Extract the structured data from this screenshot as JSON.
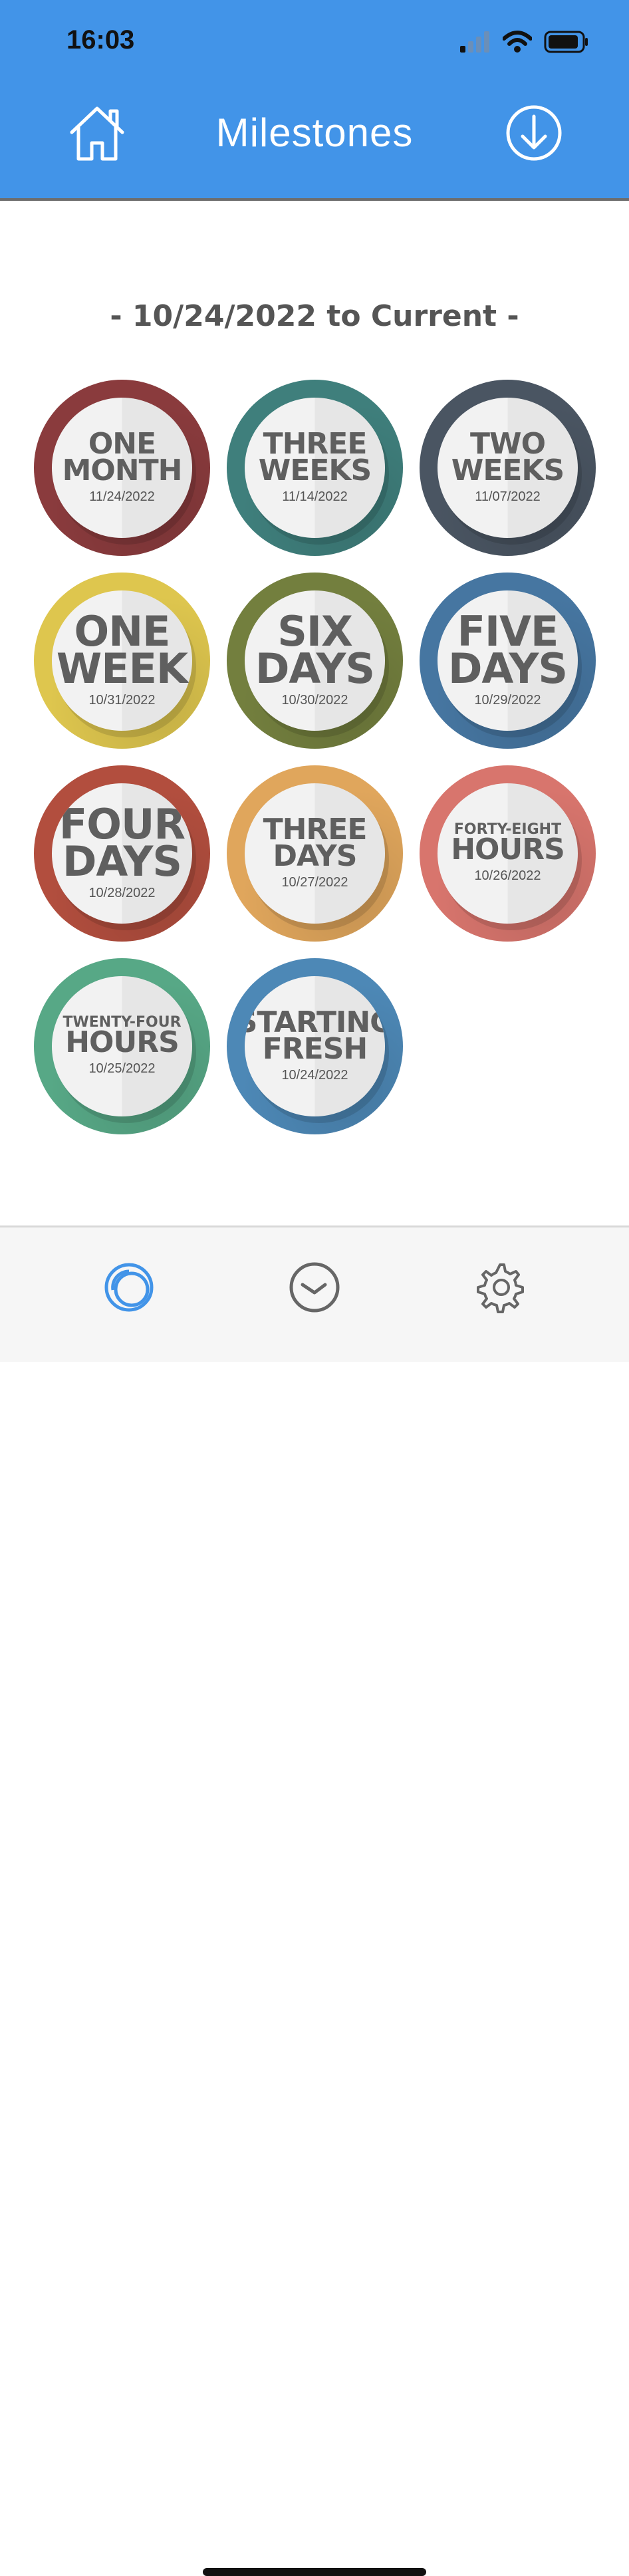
{
  "status_bar": {
    "time": "16:03"
  },
  "header": {
    "title": "Milestones",
    "left_icon": "home-icon",
    "right_icon": "download-circle-icon",
    "color": "#4294E8"
  },
  "date_range": "- 10/24/2022 to Current -",
  "milestones": [
    {
      "line1": "ONE",
      "line2": "MONTH",
      "date": "11/24/2022",
      "color": "#8A3B3D"
    },
    {
      "line1": "THREE",
      "line2": "WEEKS",
      "date": "11/14/2022",
      "color": "#3F7F7C"
    },
    {
      "line1": "TWO",
      "line2": "WEEKS",
      "date": "11/07/2022",
      "color": "#4A5562"
    },
    {
      "line1": "ONE",
      "line2": "WEEK",
      "date": "10/31/2022",
      "color": "#DEC64E"
    },
    {
      "line1": "SIX",
      "line2": "DAYS",
      "date": "10/30/2022",
      "color": "#737F3E"
    },
    {
      "line1": "FIVE",
      "line2": "DAYS",
      "date": "10/29/2022",
      "color": "#4676A1"
    },
    {
      "line1": "FOUR",
      "line2": "DAYS",
      "date": "10/28/2022",
      "color": "#B24E3E"
    },
    {
      "line1": "THREE",
      "line2": "DAYS",
      "date": "10/27/2022",
      "color": "#E0A65C"
    },
    {
      "line1": "FORTY-EIGHT",
      "line2": "HOURS",
      "date": "10/26/2022",
      "color": "#D8756D"
    },
    {
      "line1": "TWENTY-FOUR",
      "line2": "HOURS",
      "date": "10/25/2022",
      "color": "#57A886"
    },
    {
      "line1": "STARTING",
      "line2": "FRESH",
      "date": "10/24/2022",
      "color": "#4D88B6"
    }
  ],
  "tabbar": {
    "tabs": [
      {
        "icon": "milestones-rings-icon",
        "active": true
      },
      {
        "icon": "clock-icon",
        "active": false
      },
      {
        "icon": "gear-icon",
        "active": false
      }
    ],
    "active_color": "#4294E8",
    "inactive_color": "#666666"
  }
}
